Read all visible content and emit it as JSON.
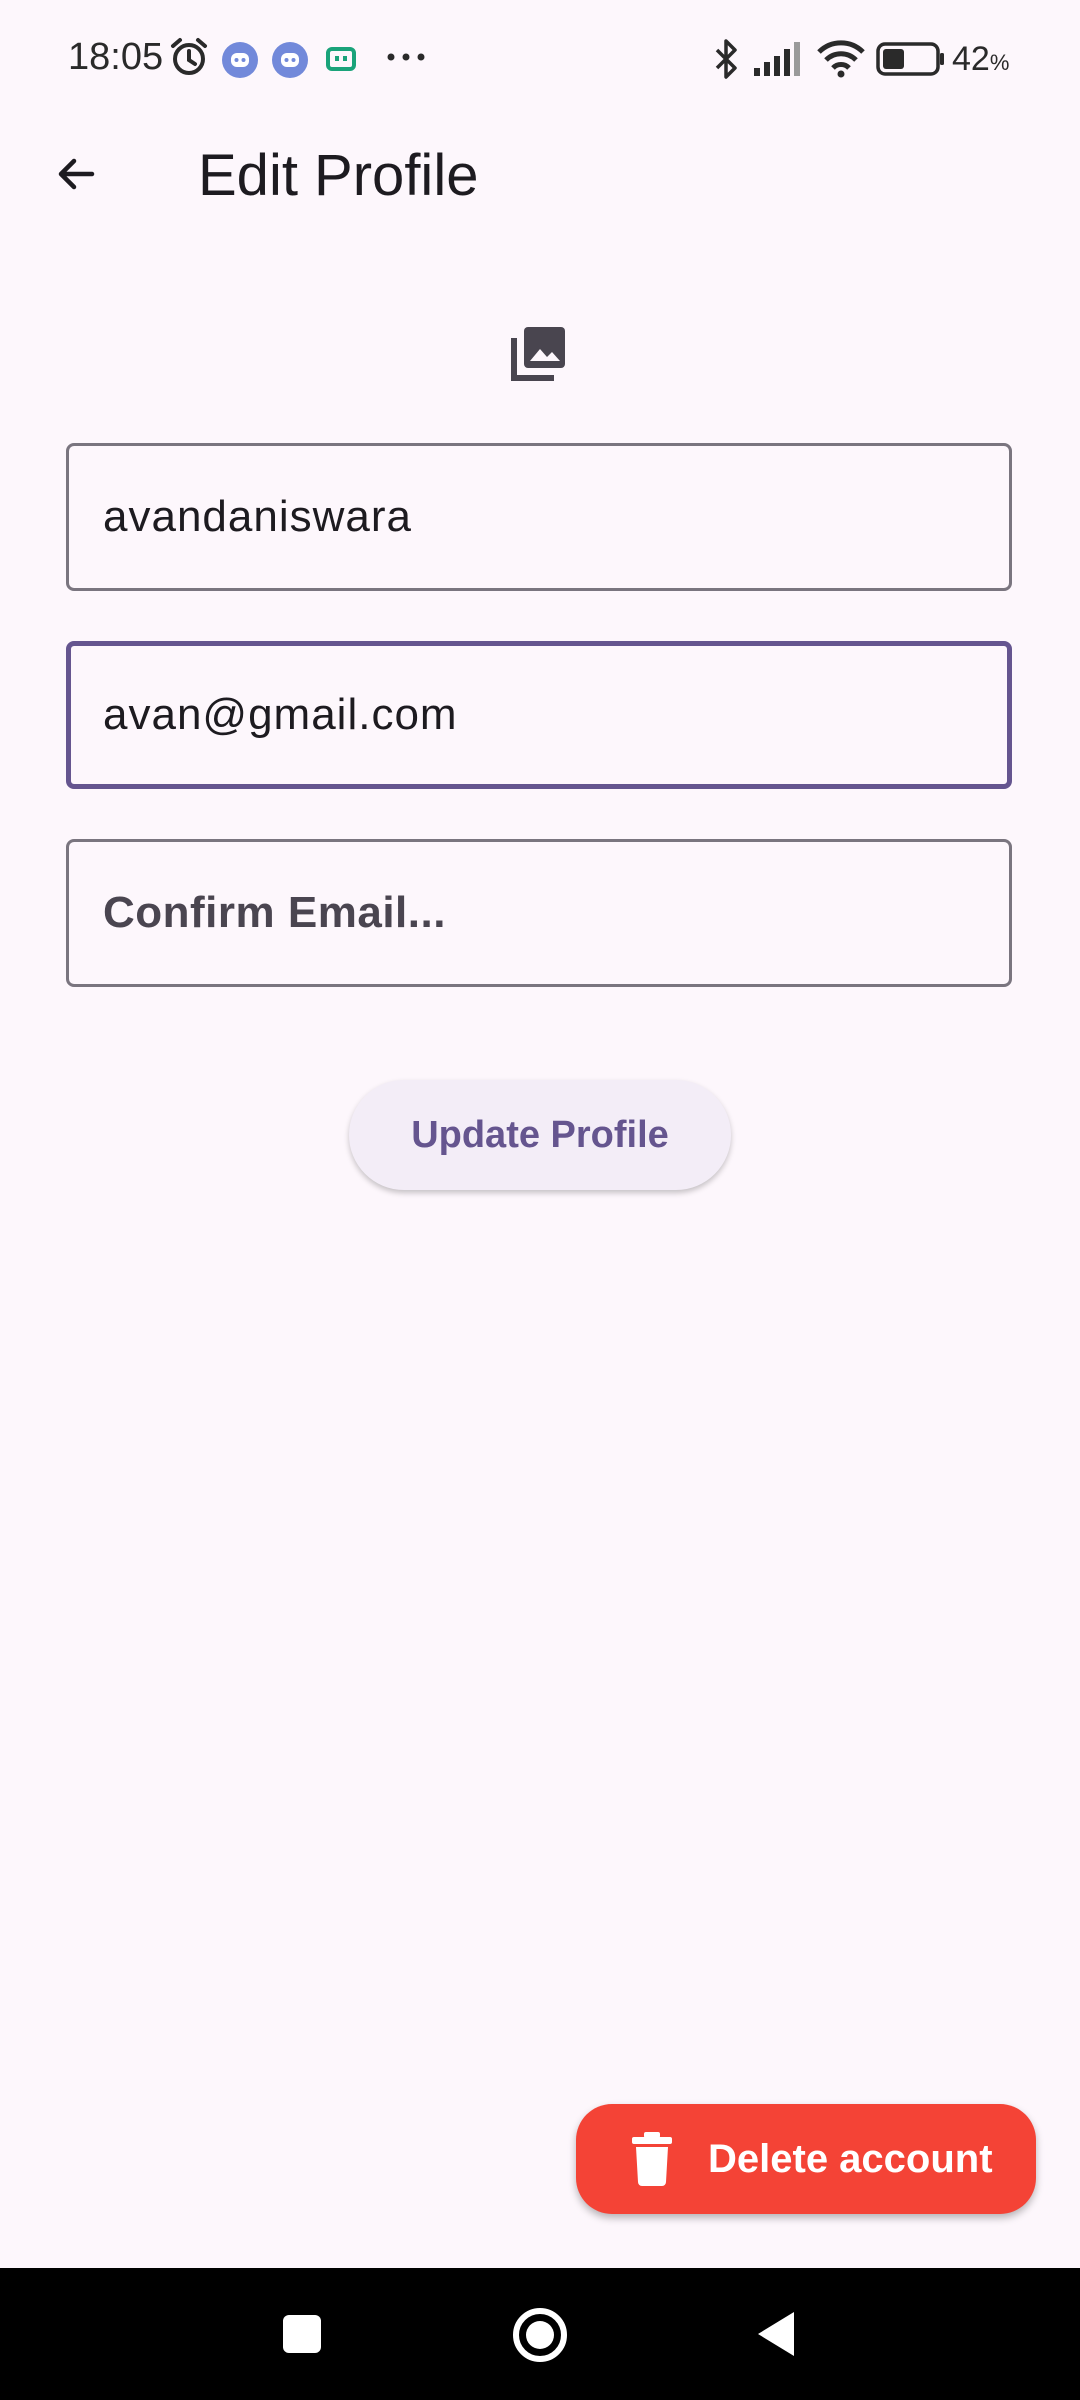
{
  "status_bar": {
    "time": "18:05",
    "battery_percent": "42",
    "battery_unit": "%",
    "battery_level": 0.42,
    "icons": [
      "alarm-icon",
      "discord-icon",
      "discord-icon",
      "notification-app-icon",
      "more-dots-icon",
      "bluetooth-icon",
      "signal-icon",
      "wifi-icon",
      "battery-icon"
    ]
  },
  "app_bar": {
    "title": "Edit Profile",
    "back_icon": "arrow-back-icon"
  },
  "profile": {
    "avatar_icon": "photo-library-icon"
  },
  "form": {
    "username_value": "avandaniswara",
    "email_value": "avan@gmail.com",
    "confirm_email_placeholder": "Confirm Email...",
    "confirm_email_value": "",
    "update_label": "Update Profile"
  },
  "actions": {
    "delete_label": "Delete account",
    "delete_icon": "trash-icon"
  },
  "colors": {
    "background": "#fdf7fc",
    "accent": "#65558f",
    "danger": "#f44336",
    "outline": "#7a757f"
  },
  "nav_bar": {
    "buttons": [
      "recents-button",
      "home-button",
      "back-button"
    ]
  }
}
